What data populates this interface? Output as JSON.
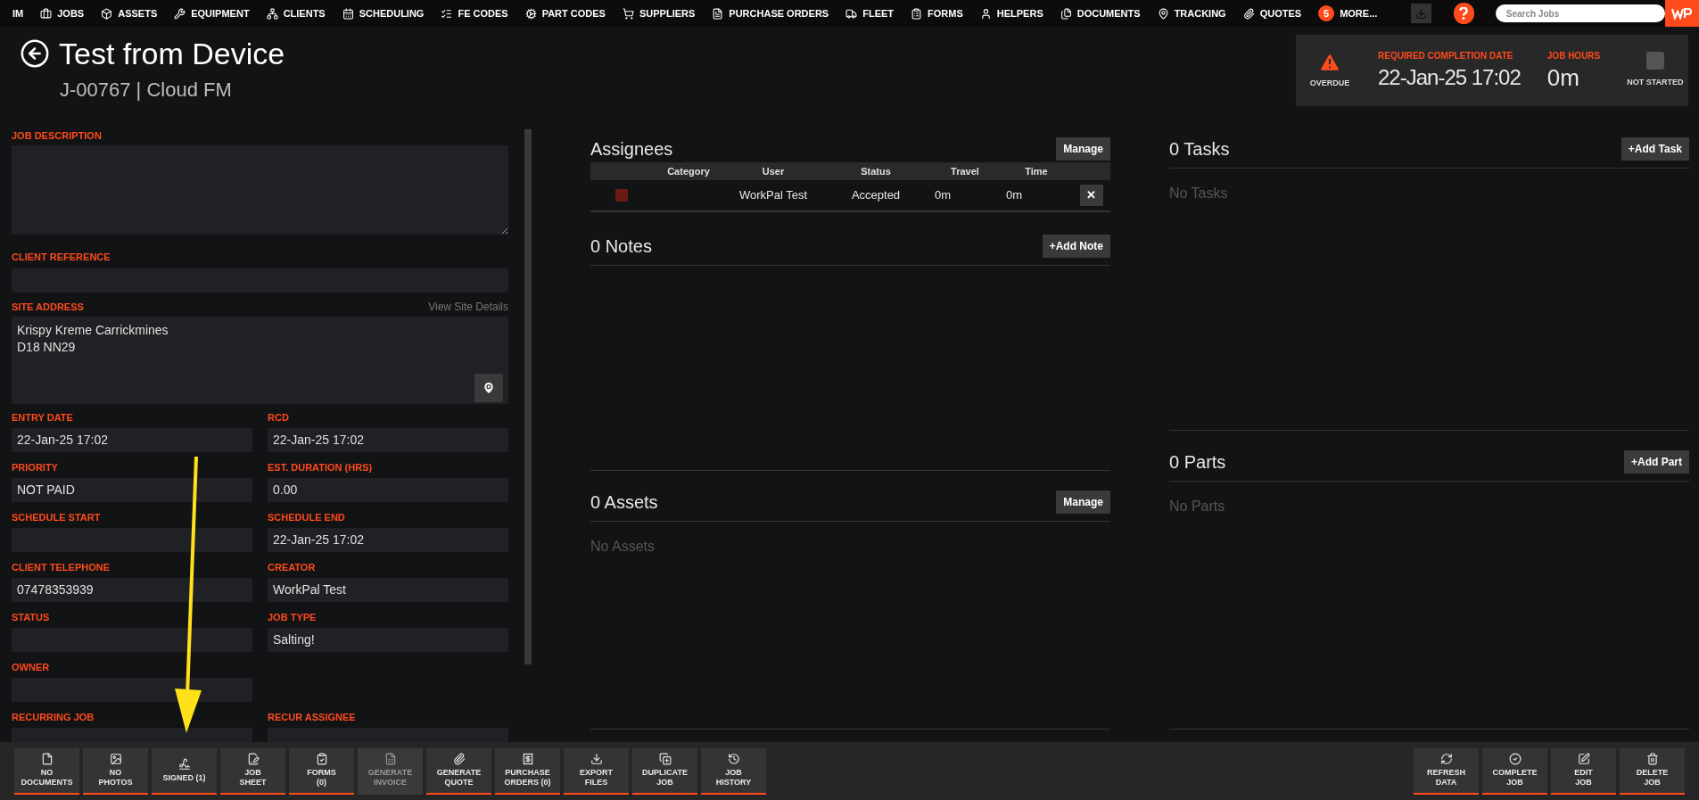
{
  "nav": {
    "items": [
      {
        "label": "IM"
      },
      {
        "label": "JOBS"
      },
      {
        "label": "ASSETS"
      },
      {
        "label": "EQUIPMENT"
      },
      {
        "label": "CLIENTS"
      },
      {
        "label": "SCHEDULING"
      },
      {
        "label": "FE CODES"
      },
      {
        "label": "PART CODES"
      },
      {
        "label": "SUPPLIERS"
      },
      {
        "label": "PURCHASE ORDERS"
      },
      {
        "label": "FLEET"
      },
      {
        "label": "FORMS"
      },
      {
        "label": "HELPERS"
      },
      {
        "label": "DOCUMENTS"
      },
      {
        "label": "TRACKING"
      },
      {
        "label": "QUOTES"
      }
    ],
    "more": {
      "count": "5",
      "label": "MORE..."
    },
    "search": {
      "placeholder": "Search Jobs"
    }
  },
  "header": {
    "title": "Test from Device",
    "subtitle": "J-00767 | Cloud FM"
  },
  "status": {
    "overdue_label": "OVERDUE",
    "rcd_label": "REQUIRED COMPLETION DATE",
    "rcd_value": "22-Jan-25 17:02",
    "hours_label": "JOB HOURS",
    "hours_value": "0m",
    "started_label": "NOT STARTED",
    "started": false
  },
  "form": {
    "job_description": {
      "label": "JOB DESCRIPTION"
    },
    "client_reference": {
      "label": "CLIENT REFERENCE"
    },
    "site_address": {
      "label": "SITE ADDRESS",
      "link": "View Site Details",
      "lines": [
        "Krispy Kreme Carrickmines",
        "D18 NN29"
      ]
    },
    "rows": [
      {
        "left": {
          "label": "ENTRY DATE",
          "value": "22-Jan-25 17:02"
        },
        "right": {
          "label": "RCD",
          "value": "22-Jan-25 17:02"
        }
      },
      {
        "left": {
          "label": "PRIORITY",
          "value": "NOT PAID"
        },
        "right": {
          "label": "EST. DURATION (HRS)",
          "value": "0.00"
        }
      },
      {
        "left": {
          "label": "SCHEDULE START"
        },
        "right": {
          "label": "SCHEDULE END",
          "value": "22-Jan-25 17:02"
        }
      },
      {
        "left": {
          "label": "CLIENT TELEPHONE",
          "value": "07478353939"
        },
        "right": {
          "label": "CREATOR",
          "value": "WorkPal Test"
        }
      },
      {
        "left": {
          "label": "STATUS"
        },
        "right": {
          "label": "JOB TYPE",
          "value": "Salting!"
        }
      },
      {
        "left": {
          "label": "OWNER"
        }
      },
      {
        "left": {
          "label": "RECURRING JOB"
        },
        "right": {
          "label": "RECUR ASSIGNEE"
        }
      }
    ]
  },
  "assignees": {
    "title": "Assignees",
    "button": "Manage",
    "columns": [
      "Category",
      "User",
      "Status",
      "Travel",
      "Time"
    ],
    "rows": [
      {
        "color": "#6b1c12",
        "user": "WorkPal Test",
        "status": "Accepted",
        "travel": "0m",
        "time": "0m",
        "remove": "✕"
      }
    ]
  },
  "notes": {
    "title": "0 Notes",
    "button": "+Add Note"
  },
  "assets": {
    "title": "0 Assets",
    "button": "Manage",
    "empty": "No Assets"
  },
  "tasks": {
    "title": "0 Tasks",
    "button": "+Add Task",
    "empty": "No Tasks"
  },
  "parts": {
    "title": "0 Parts",
    "button": "+Add Part",
    "empty": "No Parts"
  },
  "toolbar_left": [
    {
      "lines": [
        "NO",
        "DOCUMENTS"
      ],
      "disabled": false
    },
    {
      "lines": [
        "NO",
        "PHOTOS"
      ],
      "disabled": false
    },
    {
      "lines": [
        "SIGNED (1)"
      ],
      "disabled": false
    },
    {
      "lines": [
        "JOB",
        "SHEET"
      ],
      "disabled": false
    },
    {
      "lines": [
        "FORMS",
        "(0)"
      ],
      "disabled": false
    },
    {
      "lines": [
        "GENERATE",
        "INVOICE"
      ],
      "disabled": true
    },
    {
      "lines": [
        "GENERATE",
        "QUOTE"
      ],
      "disabled": false
    },
    {
      "lines": [
        "PURCHASE",
        "ORDERS (0)"
      ],
      "disabled": false
    },
    {
      "lines": [
        "EXPORT",
        "FILES"
      ],
      "disabled": false
    },
    {
      "lines": [
        "DUPLICATE",
        "JOB"
      ],
      "disabled": false
    },
    {
      "lines": [
        "JOB",
        "HISTORY"
      ],
      "disabled": false
    }
  ],
  "toolbar_right": [
    {
      "lines": [
        "REFRESH",
        "DATA"
      ],
      "disabled": false
    },
    {
      "lines": [
        "COMPLETE",
        "JOB"
      ],
      "disabled": false
    },
    {
      "lines": [
        "EDIT",
        "JOB"
      ],
      "disabled": false
    },
    {
      "lines": [
        "DELETE",
        "JOB"
      ],
      "disabled": false
    }
  ]
}
